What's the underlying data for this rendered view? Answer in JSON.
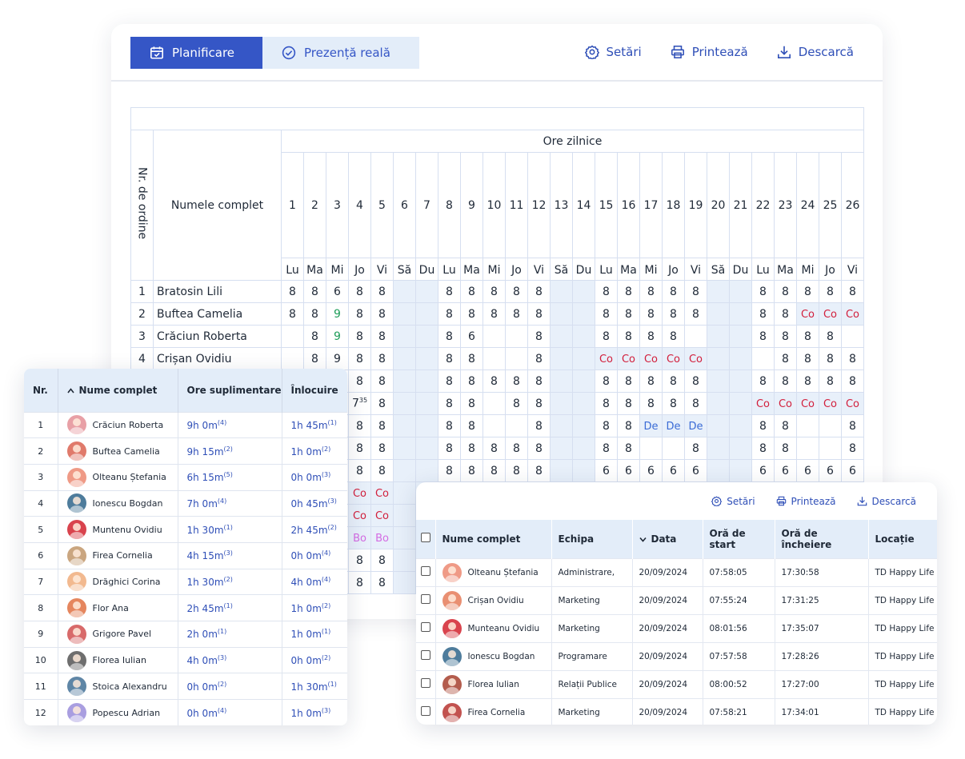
{
  "colors": {
    "accent": "#3556c6",
    "light_accent": "#e3edf9",
    "co": "#d21f3c",
    "de": "#3a6bd6",
    "bo": "#d46be3",
    "green": "#1f9d5a"
  },
  "toolbar": {
    "tab_planning": "Planificare",
    "tab_presence": "Prezență reală",
    "settings": "Setări",
    "print": "Printează",
    "download": "Descarcă"
  },
  "timesheet": {
    "col_order": "Nr. de ordine",
    "col_name": "Numele complet",
    "group_header": "Ore zilnice",
    "days": [
      "1",
      "2",
      "3",
      "4",
      "5",
      "6",
      "7",
      "8",
      "9",
      "10",
      "11",
      "12",
      "13",
      "14",
      "15",
      "16",
      "17",
      "18",
      "19",
      "20",
      "21",
      "22",
      "23",
      "24",
      "25",
      "26"
    ],
    "weekdays": [
      "Lu",
      "Ma",
      "Mi",
      "Jo",
      "Vi",
      "Să",
      "Du",
      "Lu",
      "Ma",
      "Mi",
      "Jo",
      "Vi",
      "Să",
      "Du",
      "Lu",
      "Ma",
      "Mi",
      "Jo",
      "Vi",
      "Să",
      "Du",
      "Lu",
      "Ma",
      "Mi",
      "Jo",
      "Vi"
    ],
    "rows": [
      {
        "nr": "1",
        "name": "Bratosin Lili",
        "cells": [
          "8",
          "8",
          "6",
          "8",
          "8",
          "",
          "",
          "8",
          "8",
          "8",
          "8",
          "8",
          "",
          "",
          "8",
          "8",
          "8",
          "8",
          "8",
          "",
          "",
          "8",
          "8",
          "8",
          "8",
          "8"
        ]
      },
      {
        "nr": "2",
        "name": "Buftea Camelia",
        "cells": [
          "8",
          "8",
          "9",
          "8",
          "8",
          "",
          "",
          "8",
          "8",
          "8",
          "8",
          "8",
          "",
          "",
          "8",
          "8",
          "8",
          "8",
          "8",
          "",
          "",
          "8",
          "8",
          "Co",
          "Co",
          "Co"
        ]
      },
      {
        "nr": "3",
        "name": "Crăciun Roberta",
        "cells": [
          "",
          "8",
          "9",
          "8",
          "8",
          "",
          "",
          "8",
          "6",
          "",
          "",
          "8",
          "",
          "",
          "8",
          "8",
          "8",
          "8",
          "",
          "",
          "",
          "8",
          "8",
          "8",
          "8",
          ""
        ]
      },
      {
        "nr": "4",
        "name": "Crișan Ovidiu",
        "cells": [
          "",
          "8",
          "9",
          "8",
          "8",
          "",
          "",
          "8",
          "8",
          "",
          "",
          "8",
          "",
          "",
          "Co",
          "Co",
          "Co",
          "Co",
          "Co",
          "",
          "",
          "",
          "8",
          "8",
          "8",
          "8"
        ]
      },
      {
        "nr": "",
        "name": "",
        "cells": [
          "",
          "",
          "",
          "8",
          "8",
          "",
          "",
          "8",
          "8",
          "8",
          "8",
          "8",
          "",
          "",
          "8",
          "8",
          "8",
          "8",
          "8",
          "",
          "",
          "8",
          "8",
          "8",
          "8",
          "8"
        ]
      },
      {
        "nr": "",
        "name": "",
        "cells": [
          "",
          "",
          "",
          "7",
          "8",
          "",
          "",
          "8",
          "8",
          "",
          "8",
          "8",
          "",
          "",
          "8",
          "8",
          "8",
          "8",
          "8",
          "",
          "",
          "Co",
          "Co",
          "Co",
          "Co",
          "Co"
        ]
      },
      {
        "nr": "",
        "name": "",
        "cells": [
          "",
          "",
          "",
          "8",
          "8",
          "",
          "",
          "8",
          "8",
          "",
          "",
          "8",
          "",
          "",
          "8",
          "8",
          "De",
          "De",
          "De",
          "",
          "",
          "8",
          "8",
          "",
          "",
          "8"
        ]
      },
      {
        "nr": "",
        "name": "",
        "cells": [
          "",
          "",
          "",
          "8",
          "8",
          "",
          "",
          "8",
          "8",
          "8",
          "8",
          "8",
          "",
          "",
          "8",
          "8",
          "",
          "",
          "8",
          "",
          "",
          "8",
          "8",
          "",
          "",
          "8"
        ]
      },
      {
        "nr": "",
        "name": "",
        "cells": [
          "",
          "",
          "",
          "8",
          "8",
          "",
          "",
          "8",
          "8",
          "8",
          "8",
          "8",
          "",
          "",
          "6",
          "6",
          "6",
          "6",
          "6",
          "",
          "",
          "6",
          "6",
          "6",
          "6",
          "6"
        ]
      },
      {
        "nr": "",
        "name": "",
        "cells": [
          "",
          "",
          "",
          "Co",
          "Co",
          "",
          "",
          "",
          "",
          "",
          "",
          "",
          "",
          "",
          "",
          "",
          "",
          "",
          "",
          "",
          "",
          "",
          "",
          "",
          "",
          ""
        ]
      },
      {
        "nr": "",
        "name": "",
        "cells": [
          "",
          "",
          "",
          "Co",
          "Co",
          "",
          "",
          "",
          "",
          "",
          "",
          "",
          "",
          "",
          "",
          "",
          "",
          "",
          "",
          "",
          "",
          "",
          "",
          "",
          "",
          ""
        ]
      },
      {
        "nr": "",
        "name": "",
        "cells": [
          "",
          "",
          "",
          "Bo",
          "Bo",
          "",
          "",
          "",
          "",
          "",
          "",
          "",
          "",
          "",
          "",
          "",
          "",
          "",
          "",
          "",
          "",
          "",
          "",
          "",
          "",
          ""
        ]
      },
      {
        "nr": "",
        "name": "",
        "cells": [
          "",
          "",
          "",
          "8",
          "8",
          "",
          "",
          "",
          "",
          "",
          "",
          "",
          "",
          "",
          "",
          "",
          "",
          "",
          "",
          "",
          "",
          "",
          "",
          "",
          "",
          ""
        ]
      },
      {
        "nr": "",
        "name": "",
        "cells": [
          "",
          "",
          "",
          "8",
          "8",
          "",
          "",
          "",
          "",
          "",
          "",
          "",
          "",
          "",
          "",
          "",
          "",
          "",
          "",
          "",
          "",
          "",
          "",
          "",
          "",
          ""
        ]
      }
    ],
    "sup_35": "35"
  },
  "overtime": {
    "headers": {
      "nr": "Nr.",
      "name": "Nume complet",
      "overtime": "Ore suplimentare",
      "replacement": "Înlocuire"
    },
    "rows": [
      {
        "nr": "1",
        "name": "Crăciun Roberta",
        "ot": "9h 0m",
        "ot_sup": "(4)",
        "rep": "1h 45m",
        "rep_sup": "(1)",
        "avatar": "#e8a0a6"
      },
      {
        "nr": "2",
        "name": "Buftea Camelia",
        "ot": "9h 15m",
        "ot_sup": "(2)",
        "rep": "1h 0m",
        "rep_sup": "(2)",
        "avatar": "#e07a6b"
      },
      {
        "nr": "3",
        "name": "Olteanu Ștefania",
        "ot": "6h 15m",
        "ot_sup": "(5)",
        "rep": "0h 0m",
        "rep_sup": "(3)",
        "avatar": "#ef9a86"
      },
      {
        "nr": "4",
        "name": "Ionescu Bogdan",
        "ot": "7h 0m",
        "ot_sup": "(4)",
        "rep": "0h 45m",
        "rep_sup": "(3)",
        "avatar": "#4e7c9c"
      },
      {
        "nr": "5",
        "name": "Muntenu Ovidiu",
        "ot": "1h 30m",
        "ot_sup": "(1)",
        "rep": "2h 45m",
        "rep_sup": "(2)",
        "avatar": "#d9434d"
      },
      {
        "nr": "6",
        "name": "Firea Cornelia",
        "ot": "4h 15m",
        "ot_sup": "(3)",
        "rep": "0h 0m",
        "rep_sup": "(4)",
        "avatar": "#caa680"
      },
      {
        "nr": "7",
        "name": "Drăghici Corina",
        "ot": "1h 30m",
        "ot_sup": "(2)",
        "rep": "4h 0m",
        "rep_sup": "(4)",
        "avatar": "#f2b98f"
      },
      {
        "nr": "8",
        "name": "Flor Ana",
        "ot": "2h 45m",
        "ot_sup": "(1)",
        "rep": "1h 0m",
        "rep_sup": "(2)",
        "avatar": "#e5865e"
      },
      {
        "nr": "9",
        "name": "Grigore Pavel",
        "ot": "2h 0m",
        "ot_sup": "(1)",
        "rep": "1h 0m",
        "rep_sup": "(1)",
        "avatar": "#d86a6a"
      },
      {
        "nr": "10",
        "name": "Florea Iulian",
        "ot": "4h 0m",
        "ot_sup": "(3)",
        "rep": "0h 0m",
        "rep_sup": "(2)",
        "avatar": "#6e6e6e"
      },
      {
        "nr": "11",
        "name": "Stoica Alexandru",
        "ot": "0h 0m",
        "ot_sup": "(2)",
        "rep": "1h 30m",
        "rep_sup": "(1)",
        "avatar": "#5f86a6"
      },
      {
        "nr": "12",
        "name": "Popescu Adrian",
        "ot": "0h 0m",
        "ot_sup": "(4)",
        "rep": "1h 0m",
        "rep_sup": "(3)",
        "avatar": "#a99ee0"
      }
    ]
  },
  "attendance": {
    "toolbar": {
      "settings": "Setări",
      "print": "Printează",
      "download": "Descarcă"
    },
    "headers": {
      "name": "Nume complet",
      "team": "Echipa",
      "date": "Data",
      "start": "Oră de start",
      "end": "Oră de încheiere",
      "location": "Locație"
    },
    "rows": [
      {
        "name": "Olteanu Ștefania",
        "team": "Administrare,",
        "date": "20/09/2024",
        "start": "07:58:05",
        "end": "17:30:58",
        "location": "TD Happy Life",
        "avatar": "#ef9a86"
      },
      {
        "name": "Crișan Ovidiu",
        "team": "Marketing",
        "date": "20/09/2024",
        "start": "07:55:24",
        "end": "17:31:25",
        "location": "TD Happy Life",
        "avatar": "#e98f72"
      },
      {
        "name": "Munteanu Ovidiu",
        "team": "Marketing",
        "date": "20/09/2024",
        "start": "08:01:56",
        "end": "17:35:07",
        "location": "TD Happy Life",
        "avatar": "#d9434d"
      },
      {
        "name": "Ionescu Bogdan",
        "team": "Programare",
        "date": "20/09/2024",
        "start": "07:57:58",
        "end": "17:28:26",
        "location": "TD Happy Life",
        "avatar": "#4e7c9c"
      },
      {
        "name": "Florea Iulian",
        "team": "Relații Publice",
        "date": "20/09/2024",
        "start": "08:00:52",
        "end": "17:27:00",
        "location": "TD Happy Life",
        "avatar": "#b35c4d"
      },
      {
        "name": "Firea Cornelia",
        "team": "Marketing",
        "date": "20/09/2024",
        "start": "07:58:21",
        "end": "17:34:01",
        "location": "TD Happy Life",
        "avatar": "#c2524f"
      }
    ]
  }
}
